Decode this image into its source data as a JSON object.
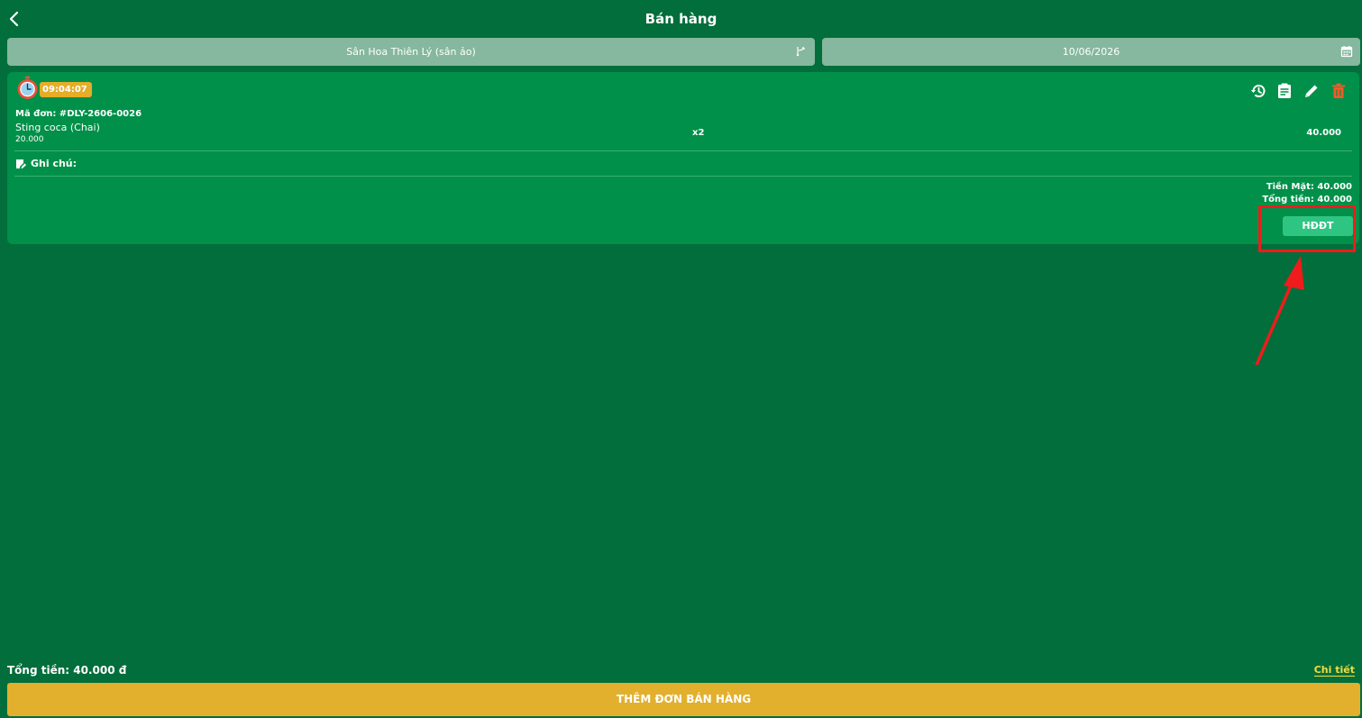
{
  "header": {
    "title": "Bán hàng"
  },
  "filters": {
    "court": "Sân Hoa Thiên Lý (sân ảo)",
    "date": "10/06/2026"
  },
  "order": {
    "timer": "09:04:07",
    "code": "Mã đơn: #DLY-2606-0026",
    "items": [
      {
        "name": "Sting coca (Chai)",
        "price": "20.000",
        "qty": "x2",
        "total": "40.000"
      }
    ],
    "note_label": "Ghi chú:",
    "cash": "Tiền Mặt: 40.000",
    "total": "Tổng tiền: 40.000",
    "einvoice_label": "HĐĐT"
  },
  "footer": {
    "total": "Tổng tiền: 40.000 đ",
    "detail_link": "Chi tiết",
    "add_order": "THÊM ĐƠN BÁN HÀNG"
  },
  "icons": {
    "back": "chevron-left-icon",
    "court_select": "switch-icon",
    "date_select": "calendar-icon",
    "timer": "stopwatch-icon",
    "history": "history-icon",
    "invoice": "receipt-icon",
    "edit": "pencil-icon",
    "delete": "trash-icon",
    "note": "note-edit-icon"
  },
  "colors": {
    "background": "#016e3b",
    "card": "#009049",
    "selector": "#85b89e",
    "accent_yellow": "#e2b02c",
    "einvoice_button": "#2ec582",
    "delete_icon": "#f05a28",
    "highlight": "#ee1c1c"
  }
}
